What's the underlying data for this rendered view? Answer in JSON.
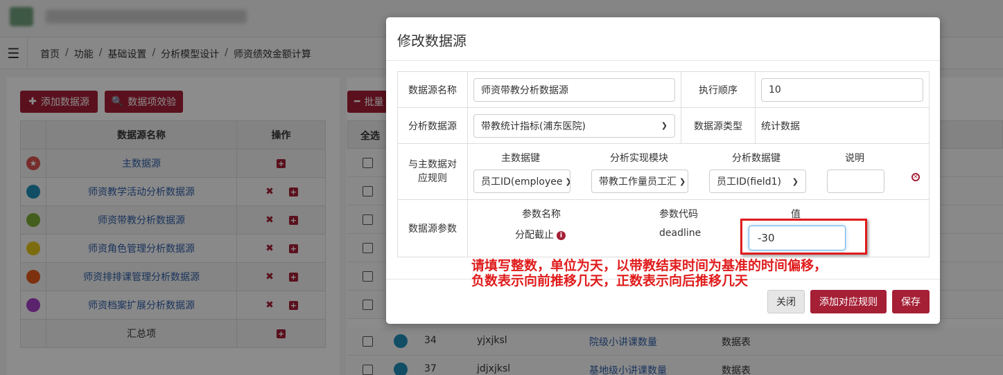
{
  "breadcrumb": [
    "首页",
    "功能",
    "基础设置",
    "分析模型设计",
    "师资绩效金额计算"
  ],
  "left": {
    "add_button": "添加数据源",
    "verify_button": "数据项效验",
    "col_name": "数据源名称",
    "col_ops": "操作",
    "rows": [
      {
        "name": "主数据源",
        "color": "#d9534f"
      },
      {
        "name": "师资教学活动分析数据源",
        "color": "#1f8fb8"
      },
      {
        "name": "师资带教分析数据源",
        "color": "#7cab35"
      },
      {
        "name": "师资角色管理分析数据源",
        "color": "#e3c51b"
      },
      {
        "name": "师资排排课管理分析数据源",
        "color": "#e35a1b"
      },
      {
        "name": "师资档案扩展分析数据源",
        "color": "#a73fc7"
      },
      {
        "name": "汇总项",
        "color": ""
      }
    ]
  },
  "right": {
    "batch_button": "批量",
    "select_all": "全选",
    "rows": [
      {
        "id": "34",
        "code": "yjxjksl",
        "name": "院级小讲课数量",
        "type": "数据表"
      },
      {
        "id": "37",
        "code": "jdjxjksl",
        "name": "基地级小讲课数量",
        "type": "数据表"
      }
    ]
  },
  "modal": {
    "title": "修改数据源",
    "name_label": "数据源名称",
    "name_value": "师资带教分析数据源",
    "order_label": "执行顺序",
    "order_value": "10",
    "source_label": "分析数据源",
    "source_value": "带教统计指标(浦东医院)",
    "type_label": "数据源类型",
    "type_value": "统计数据",
    "rule_label": "与主数据对应规则",
    "rule_headers": [
      "主数据键",
      "分析实现模块",
      "分析数据键",
      "说明"
    ],
    "rule_values": [
      "员工ID(employee",
      "带教工作量员工汇",
      "员工ID(field1)",
      ""
    ],
    "param_label": "数据源参数",
    "param_headers": [
      "参数名称",
      "参数代码",
      "值"
    ],
    "param_name": "分配截止",
    "param_code": "deadline",
    "param_value": "-30",
    "annotation_line1": "请填写整数，单位为天，以带教结束时间为基准的时间偏移，",
    "annotation_line2": "负数表示向前推移几天，正数表示向后推移几天",
    "close_button": "关闭",
    "add_rule_button": "添加对应规则",
    "save_button": "保存"
  }
}
